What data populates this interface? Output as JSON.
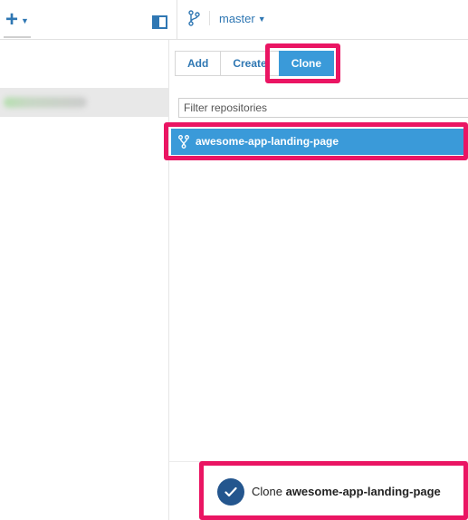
{
  "toolbar": {
    "add_icon": "plus-icon",
    "branch_icon": "branch-icon",
    "branch_name": "master"
  },
  "tabs": [
    {
      "label": "Add"
    },
    {
      "label": "Create"
    },
    {
      "label": "Clone",
      "active": true
    }
  ],
  "filter": {
    "placeholder": "Filter repositories",
    "value": ""
  },
  "repositories": [
    {
      "name": "awesome-app-landing-page",
      "icon": "fork-icon",
      "selected": true
    }
  ],
  "toast": {
    "prefix": "Clone",
    "repo": "awesome-app-landing-page",
    "icon": "checkmark-icon"
  },
  "colors": {
    "accent": "#2f77b3",
    "selection": "#3a9ad9",
    "highlight": "#ea1563",
    "toast_icon": "#24568e"
  }
}
